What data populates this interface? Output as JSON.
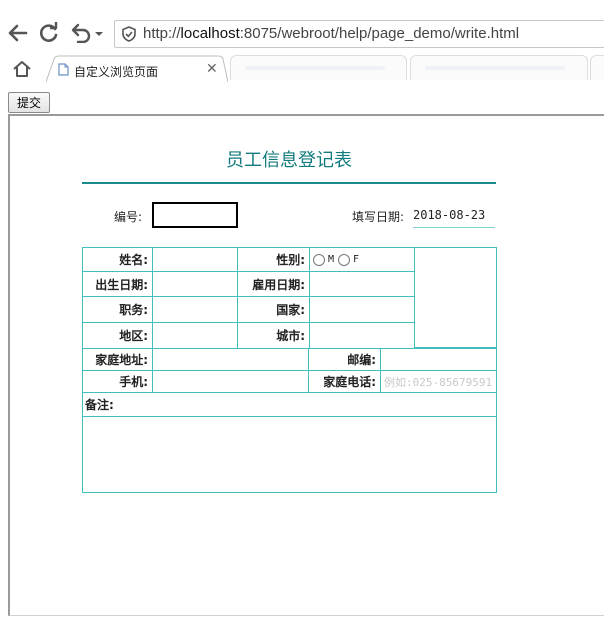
{
  "browser": {
    "url_prefix": "http://",
    "url_host": "localhost",
    "url_rest": ":8075/webroot/help/page_demo/write.html",
    "tab_title": "自定义浏览页面",
    "tooltip": "自定义浏览页面"
  },
  "toolbar": {
    "submit_label": "提交"
  },
  "form": {
    "title": "员工信息登记表",
    "id_label": "编号:",
    "date_label": "填写日期:",
    "date_value": "2018-08-23",
    "labels": {
      "name": "姓名:",
      "gender": "性别:",
      "birth_date": "出生日期:",
      "hire_date": "雇用日期:",
      "position": "职务:",
      "country": "国家:",
      "region": "地区:",
      "city": "城市:",
      "address": "家庭地址:",
      "postcode": "邮编:",
      "mobile": "手机:",
      "home_phone": "家庭电话:",
      "notes": "备注:"
    },
    "gender_options": [
      "M",
      "F"
    ],
    "home_phone_placeholder": "例如:025-85679591"
  },
  "colors": {
    "accent": "#137b7e",
    "grid_border": "#41bfbf"
  }
}
